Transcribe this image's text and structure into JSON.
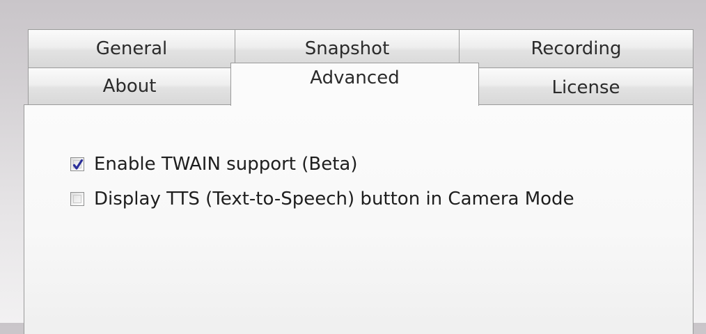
{
  "tabs": {
    "row1": [
      {
        "label": "General",
        "selected": false
      },
      {
        "label": "Snapshot",
        "selected": false
      },
      {
        "label": "Recording",
        "selected": false
      }
    ],
    "row2": [
      {
        "label": "About",
        "selected": false
      },
      {
        "label": "Advanced",
        "selected": true
      },
      {
        "label": "License",
        "selected": false
      }
    ]
  },
  "advanced": {
    "options": [
      {
        "label": "Enable TWAIN support (Beta)",
        "checked": true
      },
      {
        "label": "Display TTS (Text-to-Speech) button in Camera Mode",
        "checked": false
      }
    ]
  },
  "colors": {
    "check_mark": "#2b2f9a",
    "border": "#9a9a9a"
  },
  "icons": {
    "checked": "check-mark-icon"
  }
}
